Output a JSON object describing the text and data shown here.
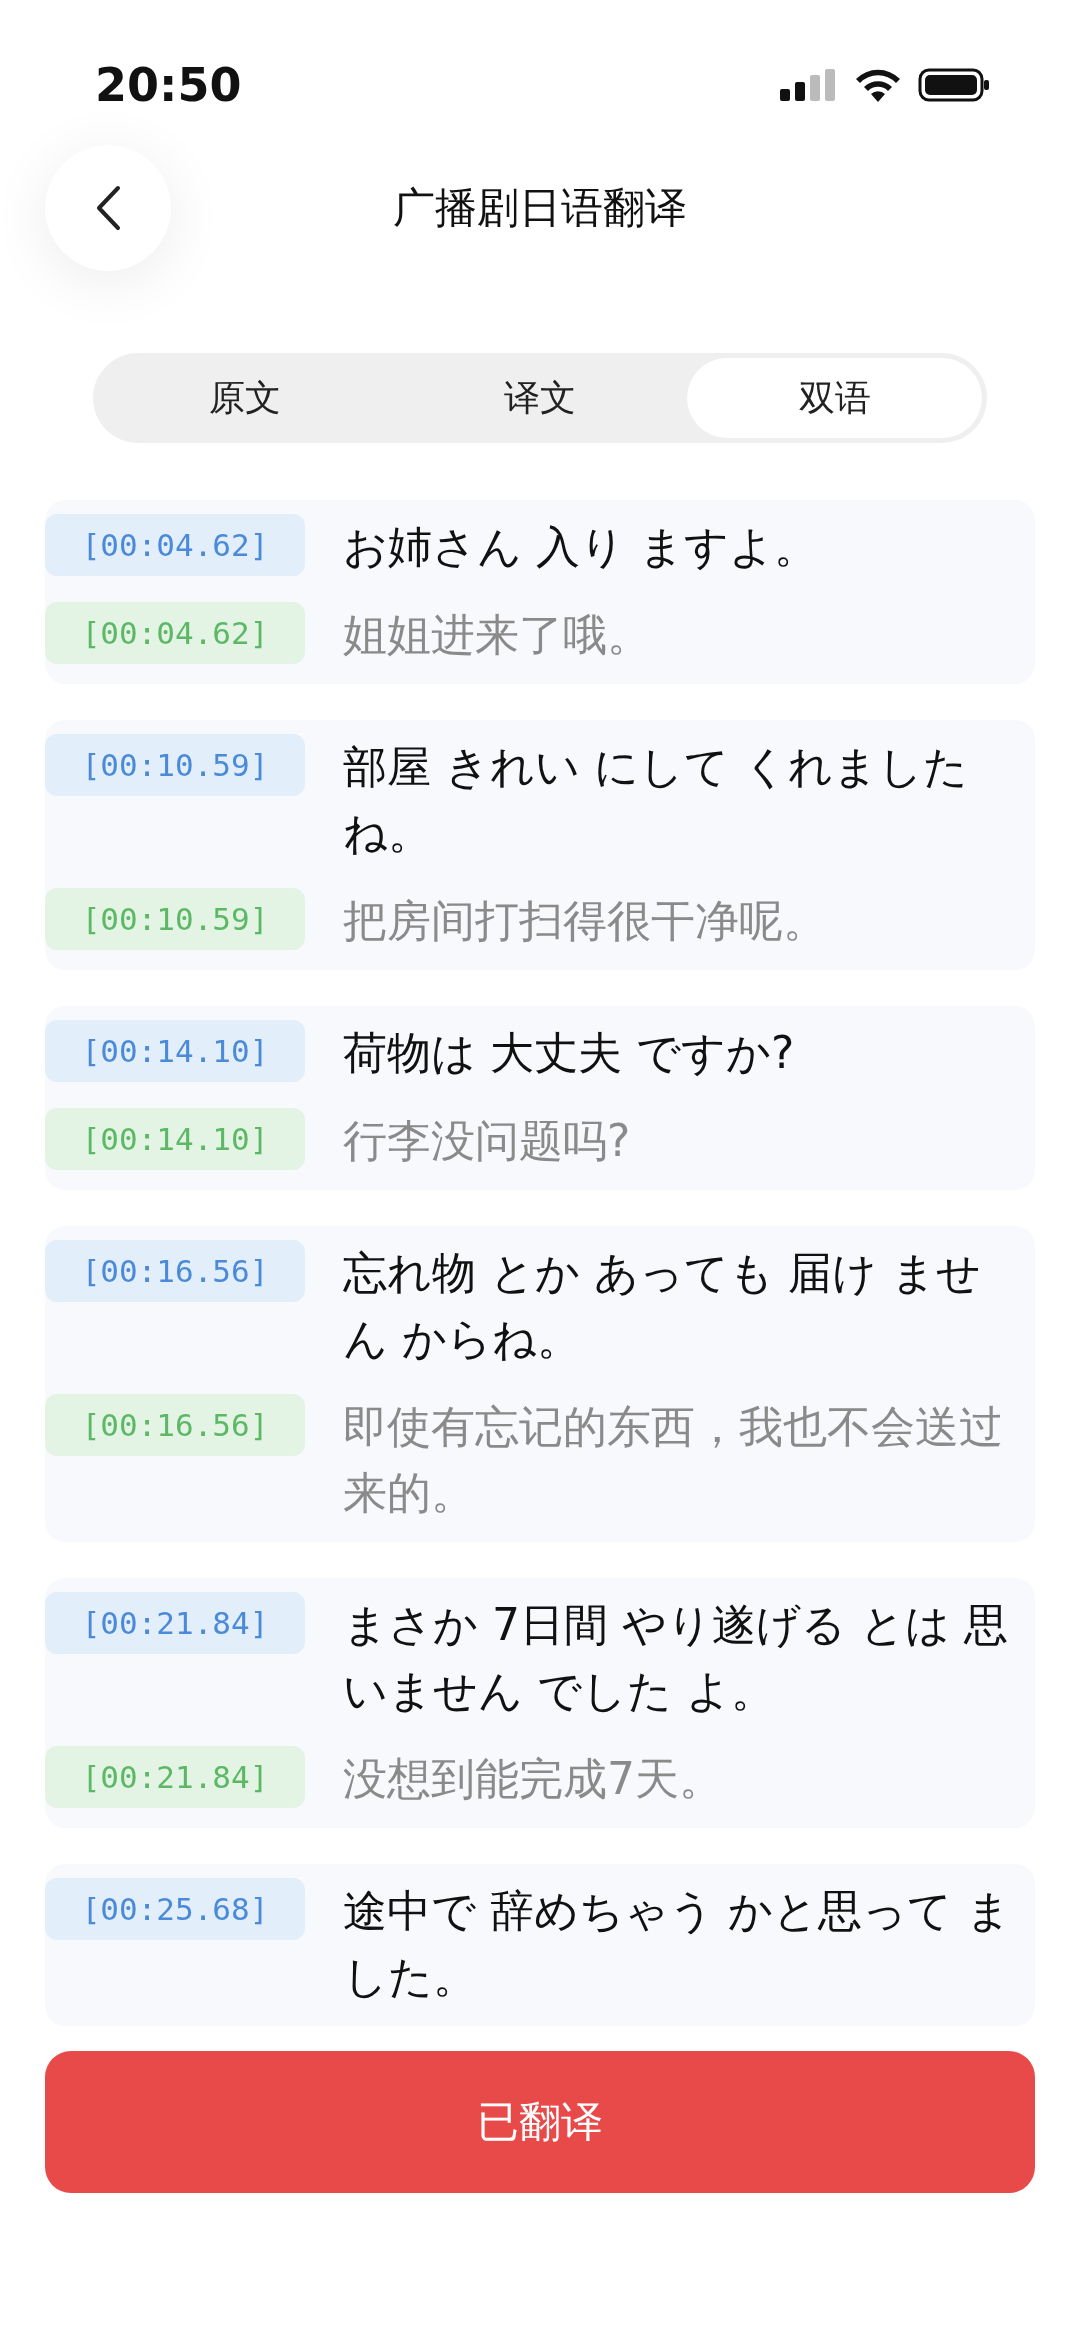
{
  "status_bar": {
    "time": "20:50"
  },
  "header": {
    "title": "广播剧日语翻译"
  },
  "tabs": [
    {
      "label": "原文",
      "selected": false
    },
    {
      "label": "译文",
      "selected": false
    },
    {
      "label": "双语",
      "selected": true
    }
  ],
  "lines": [
    {
      "original": {
        "time": "[00:04.62]",
        "text": "お姉さん 入り ますよ。"
      },
      "translation": {
        "time": "[00:04.62]",
        "text": "姐姐进来了哦。"
      }
    },
    {
      "original": {
        "time": "[00:10.59]",
        "text": "部屋 きれい にして くれましたね。"
      },
      "translation": {
        "time": "[00:10.59]",
        "text": "把房间打扫得很干净呢。"
      }
    },
    {
      "original": {
        "time": "[00:14.10]",
        "text": "荷物は 大丈夫 ですか?"
      },
      "translation": {
        "time": "[00:14.10]",
        "text": "行李没问题吗?"
      }
    },
    {
      "original": {
        "time": "[00:16.56]",
        "text": "忘れ物 とか あっても 届け ません からね。"
      },
      "translation": {
        "time": "[00:16.56]",
        "text": "即使有忘记的东西，我也不会送过来的。"
      }
    },
    {
      "original": {
        "time": "[00:21.84]",
        "text": "まさか 7日間 やり遂げる とは 思いません でした よ。"
      },
      "translation": {
        "time": "[00:21.84]",
        "text": "没想到能完成7天。"
      }
    },
    {
      "original": {
        "time": "[00:25.68]",
        "text": "途中で 辞めちゃう かと思って ました。"
      }
    }
  ],
  "button": {
    "label": "已翻译"
  }
}
